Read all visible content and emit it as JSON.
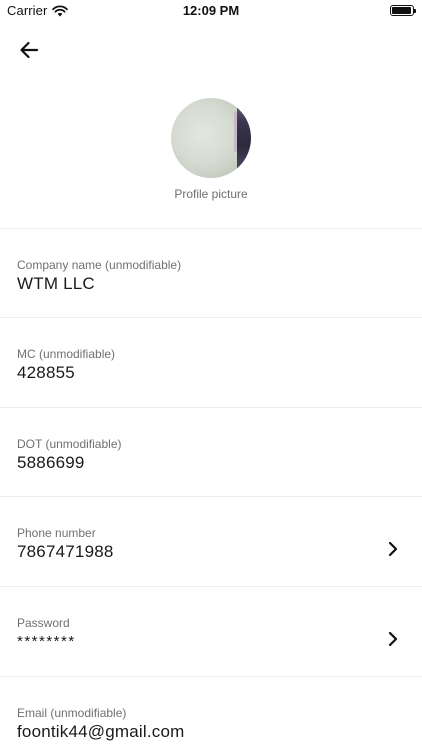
{
  "status_bar": {
    "carrier": "Carrier",
    "time": "12:09 PM",
    "icons": [
      "wifi-icon",
      "battery-icon"
    ]
  },
  "nav": {
    "back_icon": "arrow-left-icon"
  },
  "profile": {
    "label": "Profile picture"
  },
  "fields": [
    {
      "label": "Company name (unmodifiable)",
      "value": "WTM LLC",
      "editable": false
    },
    {
      "label": "MC (unmodifiable)",
      "value": "428855",
      "editable": false
    },
    {
      "label": "DOT (unmodifiable)",
      "value": "5886699",
      "editable": false
    },
    {
      "label": "Phone number",
      "value": "7867471988",
      "editable": true
    },
    {
      "label": "Password",
      "value": "********",
      "editable": true
    },
    {
      "label": "Email (unmodifiable)",
      "value": "foontik44@gmail.com",
      "editable": false
    }
  ],
  "colors": {
    "background": "#ffffff",
    "label": "#707070",
    "value": "#1a1a1a",
    "divider": "#ececec"
  }
}
